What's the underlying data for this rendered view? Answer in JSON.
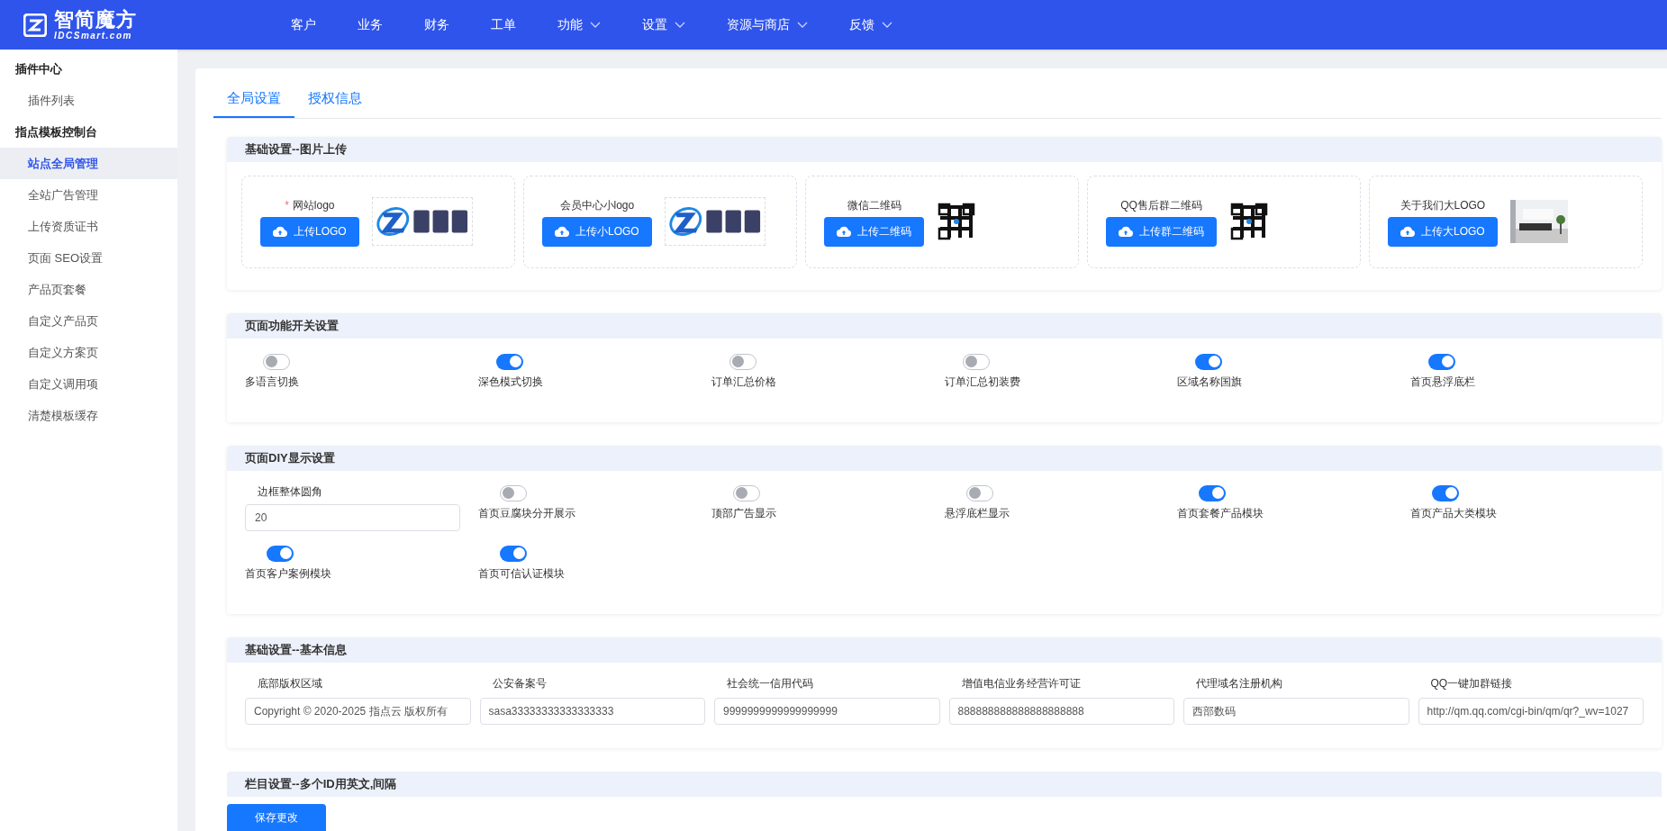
{
  "brand": {
    "name": "智简魔方",
    "domain": "IDCSmart.com"
  },
  "nav": [
    {
      "label": "客户",
      "dropdown": false
    },
    {
      "label": "业务",
      "dropdown": false
    },
    {
      "label": "财务",
      "dropdown": false
    },
    {
      "label": "工单",
      "dropdown": false
    },
    {
      "label": "功能",
      "dropdown": true
    },
    {
      "label": "设置",
      "dropdown": true
    },
    {
      "label": "资源与商店",
      "dropdown": true
    },
    {
      "label": "反馈",
      "dropdown": true
    }
  ],
  "sidebar": [
    {
      "title": "插件中心",
      "items": [
        {
          "label": "插件列表",
          "selected": false
        }
      ]
    },
    {
      "title": "指点模板控制台",
      "items": [
        {
          "label": "站点全局管理",
          "selected": true
        },
        {
          "label": "全站广告管理",
          "selected": false
        },
        {
          "label": "上传资质证书",
          "selected": false
        },
        {
          "label": "页面 SEO设置",
          "selected": false
        },
        {
          "label": "产品页套餐",
          "selected": false
        },
        {
          "label": "自定义产品页",
          "selected": false
        },
        {
          "label": "自定义方案页",
          "selected": false
        },
        {
          "label": "自定义调用项",
          "selected": false
        },
        {
          "label": "清楚模板缓存",
          "selected": false
        }
      ]
    }
  ],
  "tabs": [
    {
      "label": "全局设置",
      "selected": true
    },
    {
      "label": "授权信息",
      "selected": false
    }
  ],
  "upload_section": {
    "title": "基础设置--图片上传",
    "items": [
      {
        "label": "网站logo",
        "required_mark": "*",
        "button": "上传LOGO",
        "kind": "logo"
      },
      {
        "label": "会员中心小logo",
        "button": "上传小LOGO",
        "kind": "logo"
      },
      {
        "label": "微信二维码",
        "button": "上传二维码",
        "kind": "qr"
      },
      {
        "label": "QQ售后群二维码",
        "button": "上传群二维码",
        "kind": "qr"
      },
      {
        "label": "关于我们大LOGO",
        "button": "上传大LOGO",
        "kind": "picture"
      }
    ]
  },
  "switch_section": {
    "title": "页面功能开关设置",
    "items": [
      {
        "label": "多语言切换",
        "on": false
      },
      {
        "label": "深色模式切换",
        "on": true
      },
      {
        "label": "订单汇总价格",
        "on": false
      },
      {
        "label": "订单汇总初装费",
        "on": false
      },
      {
        "label": "区域名称国旗",
        "on": true
      },
      {
        "label": "首页悬浮底栏",
        "on": true
      }
    ]
  },
  "diy_section": {
    "title": "页面DIY显示设置",
    "items": [
      {
        "kind": "input",
        "label": "边框整体圆角",
        "value": "20"
      },
      {
        "kind": "switch",
        "label": "首页豆腐块分开展示",
        "on": false
      },
      {
        "kind": "switch",
        "label": "顶部广告显示",
        "on": false
      },
      {
        "kind": "switch",
        "label": "悬浮底栏显示",
        "on": false
      },
      {
        "kind": "switch",
        "label": "首页套餐产品模块",
        "on": true
      },
      {
        "kind": "switch",
        "label": "首页产品大类模块",
        "on": true
      },
      {
        "kind": "switch",
        "label": "首页客户案例模块",
        "on": true
      },
      {
        "kind": "switch",
        "label": "首页可信认证模块",
        "on": true
      }
    ]
  },
  "info_section": {
    "title": "基础设置--基本信息",
    "fields": [
      {
        "label": "底部版权区域",
        "value": "Copyright © 2020-2025 指点云 版权所有"
      },
      {
        "label": "公安备案号",
        "value": "sasa33333333333333333"
      },
      {
        "label": "社会统一信用代码",
        "value": "9999999999999999999"
      },
      {
        "label": "增值电信业务经营许可证",
        "value": "888888888888888888888"
      },
      {
        "label": "代理域名注册机构",
        "value": "西部数码"
      },
      {
        "label": "QQ一键加群链接",
        "value": "http://qm.qq.com/cgi-bin/qm/qr?_wv=1027"
      }
    ]
  },
  "next_section": {
    "title": "栏目设置--多个ID用英文,间隔"
  },
  "save_button": "保存更改"
}
